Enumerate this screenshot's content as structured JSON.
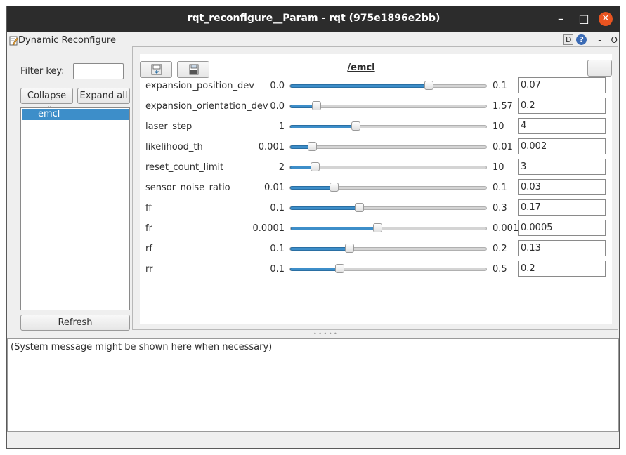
{
  "window": {
    "title": "rqt_reconfigure__Param - rqt (975e1896e2bb)",
    "minimize_glyph": "–",
    "maximize_glyph": "□",
    "close_glyph": "✕"
  },
  "plugin": {
    "title": "Dynamic Reconfigure",
    "d_label": "D",
    "help_label": "?",
    "dash_label": "-",
    "o_label": "O"
  },
  "left": {
    "filter_label": "Filter key:",
    "filter_value": "",
    "collapse_label": "Collapse all",
    "expand_label": "Expand all",
    "tree_items": [
      "emcl"
    ],
    "refresh_label": "Refresh"
  },
  "node": {
    "title": "/emcl",
    "params": [
      {
        "name": "expansion_position_dev",
        "min": "0.0",
        "max": "0.1",
        "value": "0.07",
        "fraction": 0.7
      },
      {
        "name": "expansion_orientation_dev",
        "min": "0.0",
        "max": "1.57",
        "value": "0.2",
        "fraction": 0.13
      },
      {
        "name": "laser_step",
        "min": "1",
        "max": "10",
        "value": "4",
        "fraction": 0.33
      },
      {
        "name": "likelihood_th",
        "min": "0.001",
        "max": "0.01",
        "value": "0.002",
        "fraction": 0.11
      },
      {
        "name": "reset_count_limit",
        "min": "2",
        "max": "10",
        "value": "3",
        "fraction": 0.125
      },
      {
        "name": "sensor_noise_ratio",
        "min": "0.01",
        "max": "0.1",
        "value": "0.03",
        "fraction": 0.22
      },
      {
        "name": "ff",
        "min": "0.1",
        "max": "0.3",
        "value": "0.17",
        "fraction": 0.35
      },
      {
        "name": "fr",
        "min": "0.0001",
        "max": "0.001",
        "value": "0.0005",
        "fraction": 0.44
      },
      {
        "name": "rf",
        "min": "0.1",
        "max": "0.2",
        "value": "0.13",
        "fraction": 0.3
      },
      {
        "name": "rr",
        "min": "0.1",
        "max": "0.5",
        "value": "0.2",
        "fraction": 0.25
      }
    ]
  },
  "messages": {
    "text": "(System message might be shown here when necessary)"
  },
  "colors": {
    "accent": "#3d8ec9",
    "close": "#e95420",
    "titlebar": "#2c2c2c"
  }
}
